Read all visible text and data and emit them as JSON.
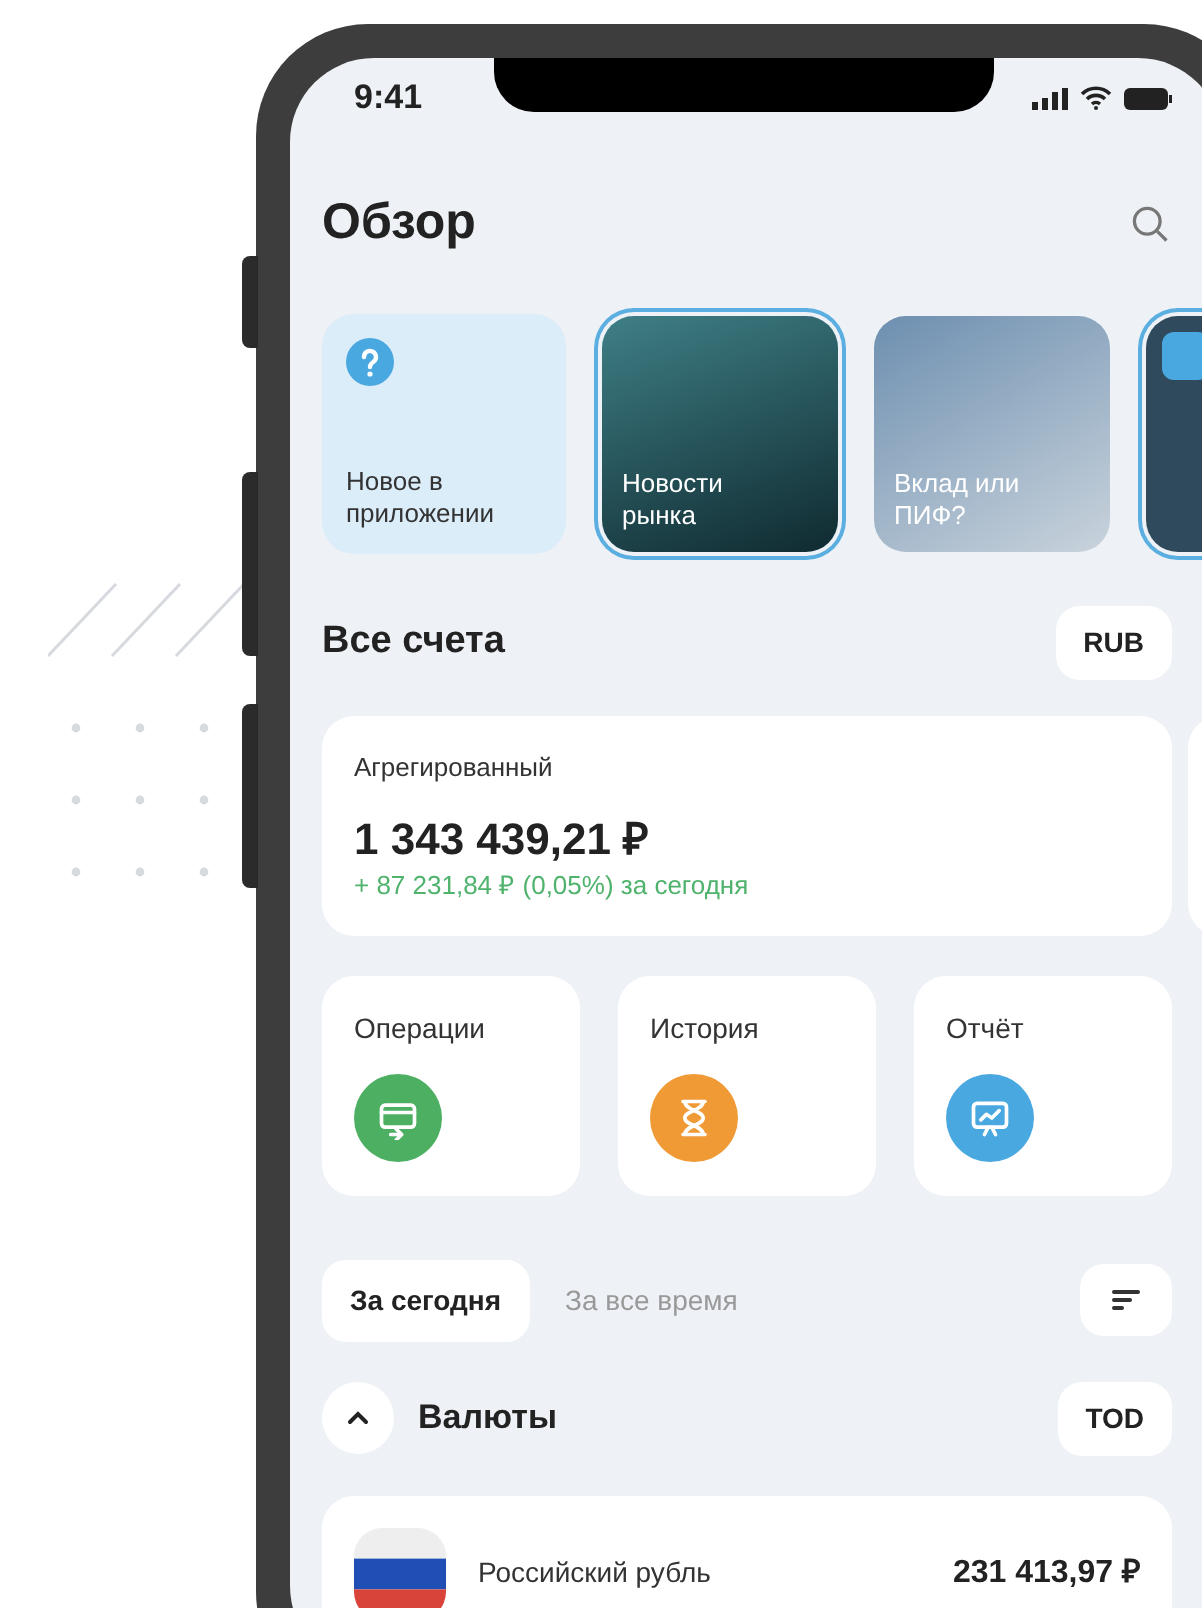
{
  "status_bar": {
    "time": "9:41"
  },
  "header": {
    "title": "Обзор"
  },
  "stories": [
    {
      "kind": "info",
      "title": "Новое в приложении",
      "highlighted": false
    },
    {
      "kind": "chart",
      "title": "Новости рынка",
      "highlighted": true
    },
    {
      "kind": "calculator",
      "title": "Вклад или ПИФ?",
      "highlighted": false
    },
    {
      "kind": "partial",
      "highlighted": true
    }
  ],
  "accounts": {
    "title": "Все счета",
    "currency": "RUB",
    "card": {
      "label": "Агрегированный",
      "total": "1 343 439,21 ₽",
      "change": "+ 87 231,84 ₽ (0,05%) за сегодня"
    }
  },
  "actions": [
    {
      "label": "Операции",
      "kind": "operations",
      "color": "#4caf62"
    },
    {
      "label": "История",
      "kind": "history",
      "color": "#f09a36"
    },
    {
      "label": "Отчёт",
      "kind": "report",
      "color": "#4aa8e0"
    }
  ],
  "period_tabs": [
    {
      "label": "За сегодня",
      "selected": true
    },
    {
      "label": "За все время",
      "selected": false
    }
  ],
  "section": {
    "title": "Валюты",
    "expanded": true,
    "mode": "TOD"
  },
  "positions": [
    {
      "name": "Российский рубль",
      "value": "231 413,97 ₽"
    }
  ]
}
